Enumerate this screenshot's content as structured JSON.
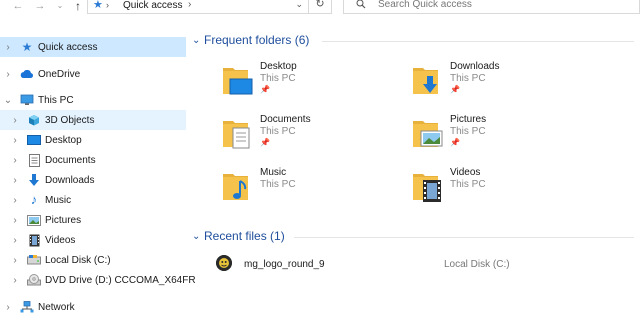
{
  "address": {
    "location": "Quick access",
    "search_placeholder": "Search Quick access"
  },
  "sidebar": {
    "items": [
      {
        "label": "Quick access",
        "icon": "star-icon"
      },
      {
        "label": "OneDrive",
        "icon": "cloud-icon"
      },
      {
        "label": "This PC",
        "icon": "computer-icon"
      },
      {
        "label": "3D Objects",
        "icon": "cube-icon"
      },
      {
        "label": "Desktop",
        "icon": "desktop-icon"
      },
      {
        "label": "Documents",
        "icon": "documents-icon"
      },
      {
        "label": "Downloads",
        "icon": "downloads-icon"
      },
      {
        "label": "Music",
        "icon": "music-icon"
      },
      {
        "label": "Pictures",
        "icon": "pictures-icon"
      },
      {
        "label": "Videos",
        "icon": "videos-icon"
      },
      {
        "label": "Local Disk (C:)",
        "icon": "disk-icon"
      },
      {
        "label": "DVD Drive (D:) CCCOMA_X64FR",
        "icon": "dvd-icon"
      },
      {
        "label": "Network",
        "icon": "network-icon"
      }
    ]
  },
  "frequent": {
    "title": "Frequent folders (6)",
    "folders": [
      {
        "name": "Desktop",
        "location": "This PC",
        "pinned": true
      },
      {
        "name": "Downloads",
        "location": "This PC",
        "pinned": true
      },
      {
        "name": "Documents",
        "location": "This PC",
        "pinned": true
      },
      {
        "name": "Pictures",
        "location": "This PC",
        "pinned": true
      },
      {
        "name": "Music",
        "location": "This PC",
        "pinned": false
      },
      {
        "name": "Videos",
        "location": "This PC",
        "pinned": false
      }
    ]
  },
  "recent": {
    "title": "Recent files (1)",
    "files": [
      {
        "name": "mg_logo_round_9",
        "location": "Local Disk (C:)"
      }
    ]
  },
  "colors": {
    "accent": "#1f4e9c",
    "folder": "#f5c24c",
    "selected": "#cde8ff",
    "hover": "#e5f3ff"
  }
}
